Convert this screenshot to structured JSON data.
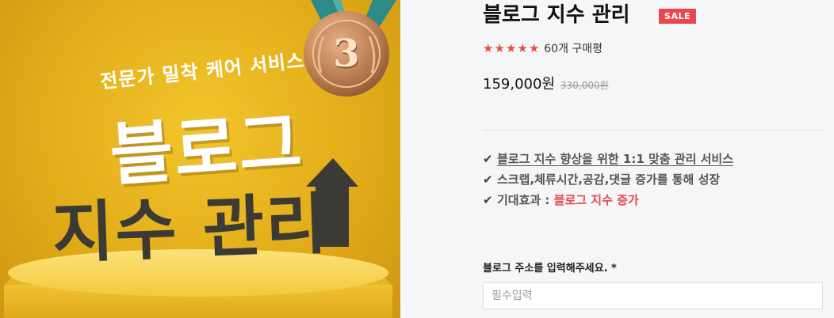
{
  "hero": {
    "subtitle": "전문가 밀착 케어 서비스",
    "title_line1": "블로그",
    "title_line2": "지수 관리",
    "medal_number": "3"
  },
  "product": {
    "title": "블로그 지수 관리",
    "sale_badge": "SALE",
    "stars": [
      "★",
      "★",
      "★",
      "★",
      "★"
    ],
    "rating": 5,
    "review_count": "60개 구매평",
    "price": "159,000원",
    "original_price": "330,000원"
  },
  "features": [
    {
      "check": "✔",
      "text": "블로그 지수 향상을 위한 1:1 맞춤 관리 서비스"
    },
    {
      "check": "✔",
      "text": "스크랩,체류시간,공감,댓글 증가를 통해 성장"
    },
    {
      "check": "✔",
      "prefix": "기대효과 : ",
      "highlight": "블로그 지수 증가"
    }
  ],
  "form": {
    "label": "블로그 주소를 입력해주세요. *",
    "placeholder": "필수입력",
    "value": ""
  },
  "colors": {
    "accent_red": "#e8484d",
    "star": "#ea4b3c",
    "hero_yellow": "#e2ad1a"
  }
}
